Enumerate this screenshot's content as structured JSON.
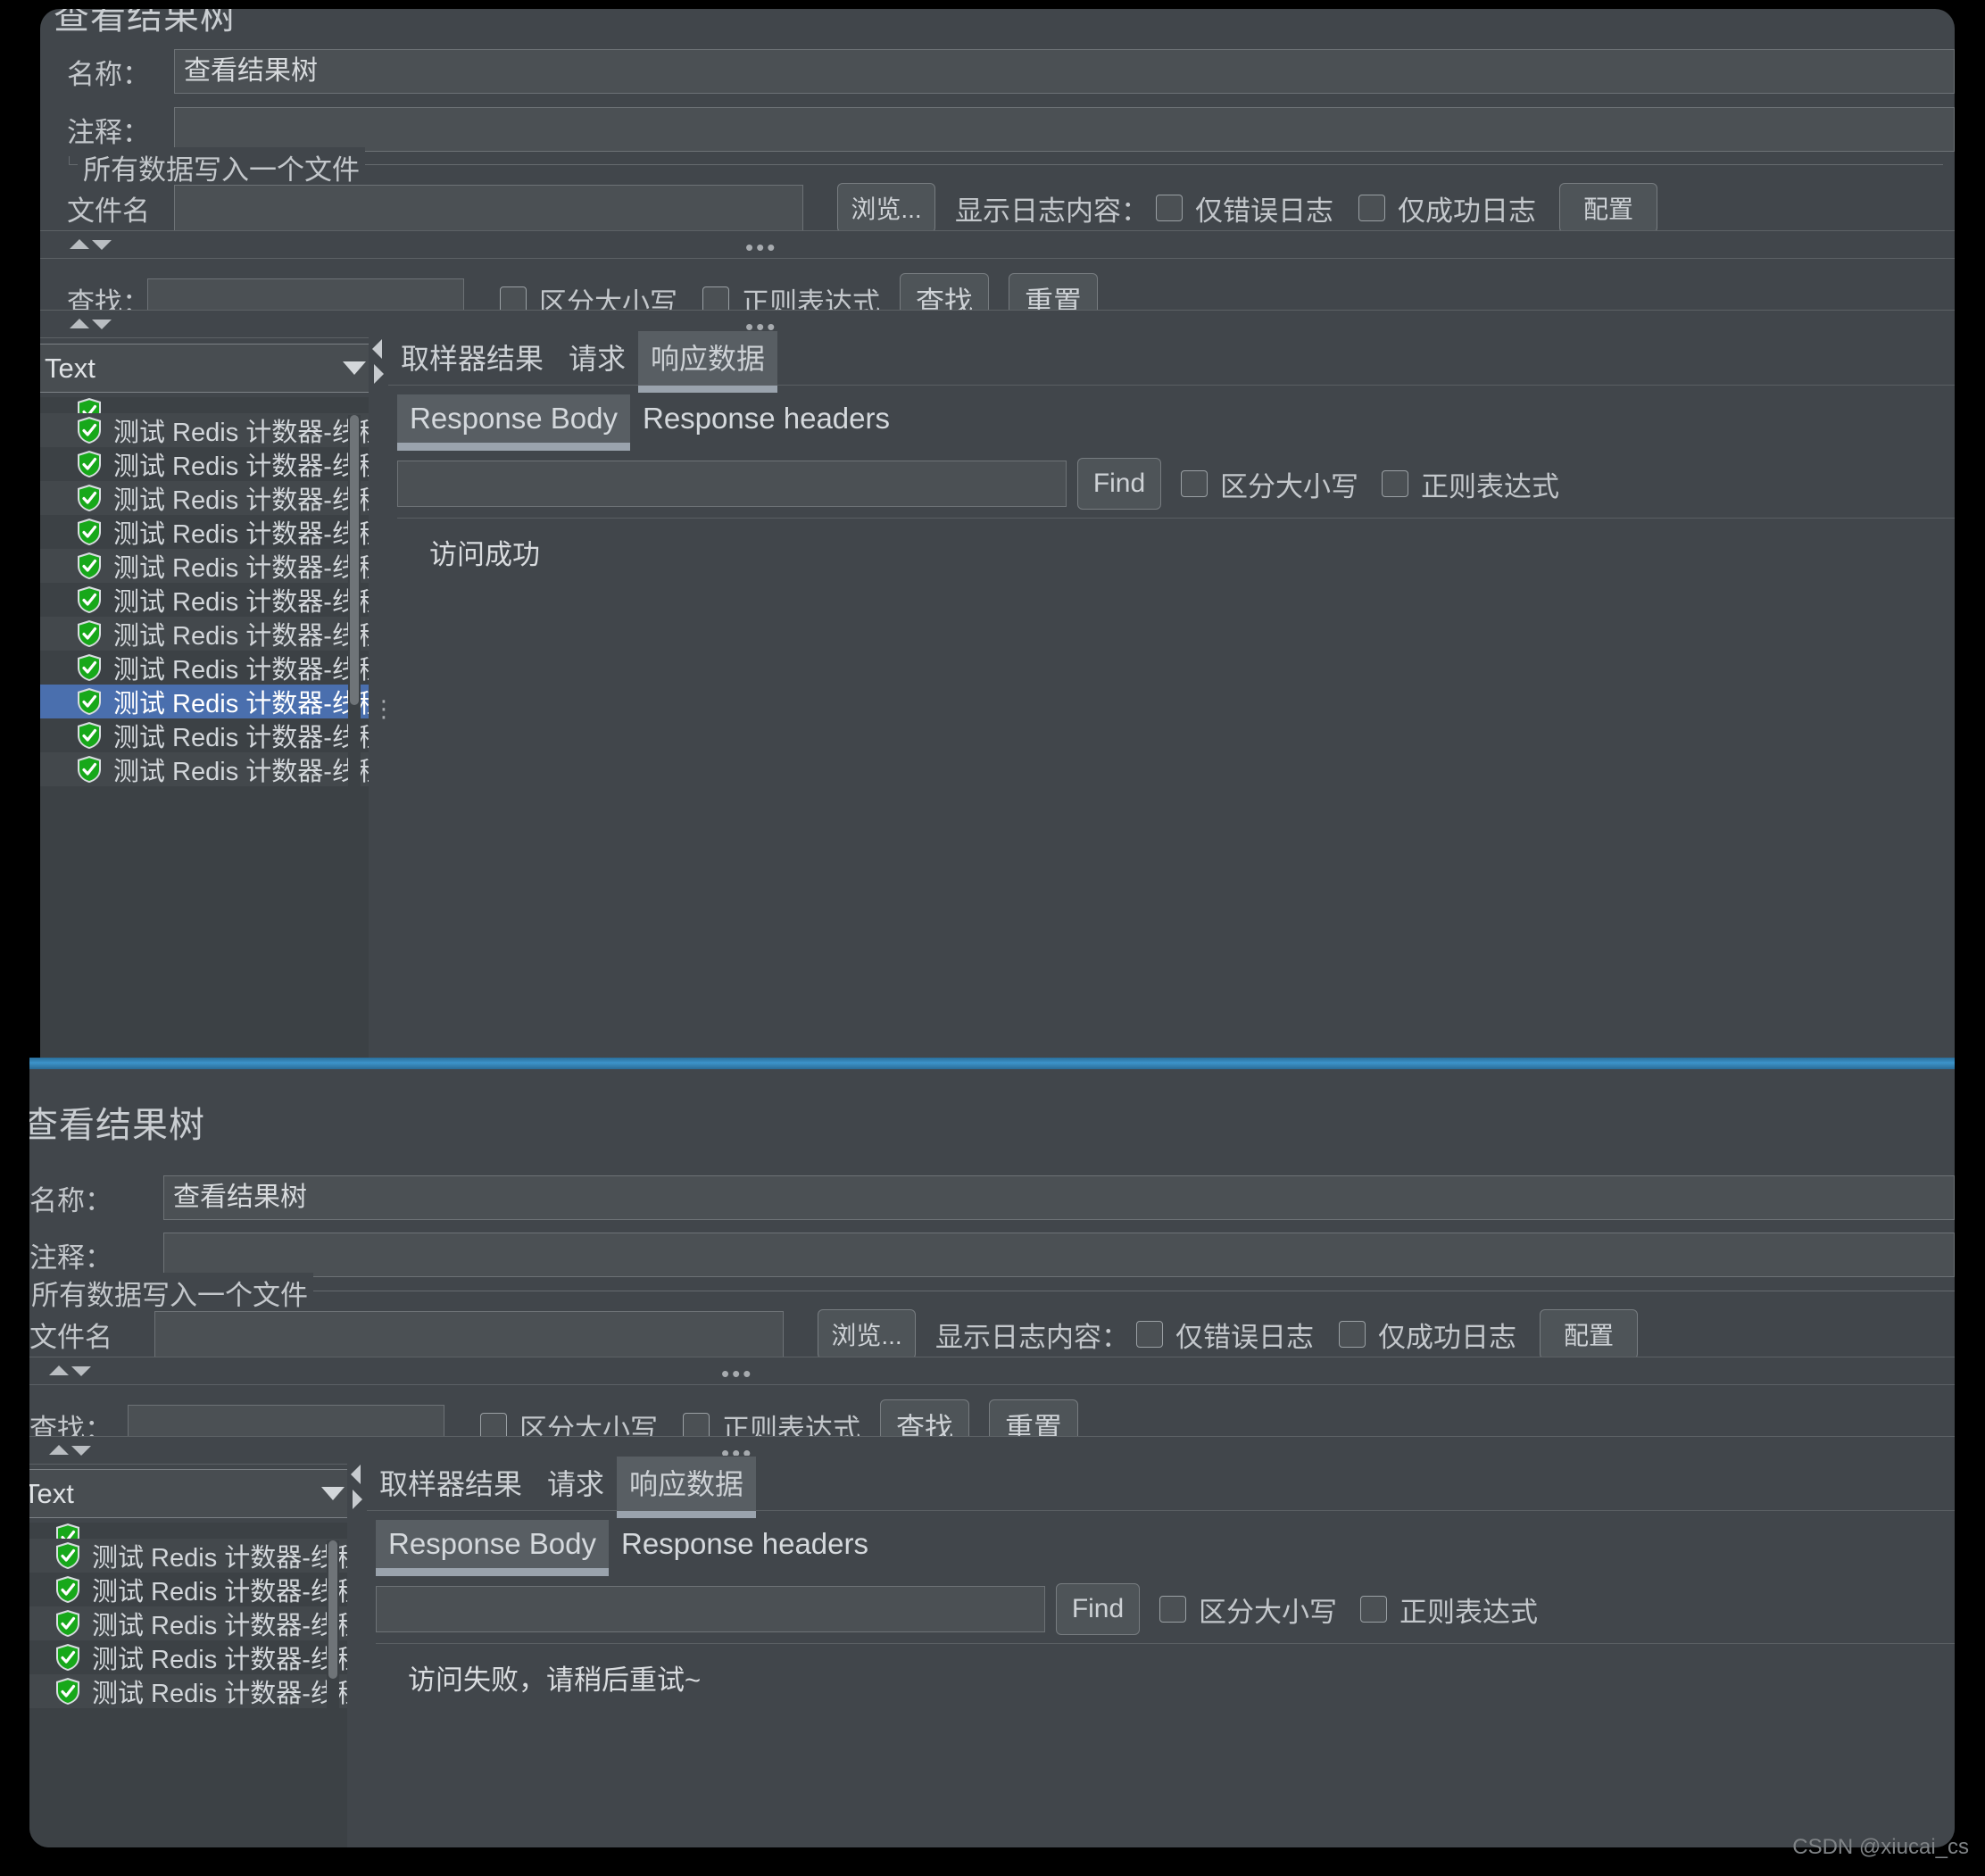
{
  "window_top": {
    "title": "查看结果树",
    "name_label": "名称：",
    "name_value": "查看结果树",
    "comment_label": "注释：",
    "comment_value": "",
    "group_caption": "所有数据写入一个文件",
    "filename_label": "文件名",
    "filename_value": "",
    "browse_button": "浏览...",
    "log_label": "显示日志内容：",
    "cb_error_only": "仅错误日志",
    "cb_success_only": "仅成功日志",
    "config_button": "配置",
    "search_label": "查找：",
    "search_value": "",
    "cb_match_case": "区分大小写",
    "cb_regex": "正则表达式",
    "find_button": "查找",
    "reset_button": "重置",
    "render_selector": "Text",
    "tabs": [
      {
        "label": "取样器结果",
        "active": false
      },
      {
        "label": "请求",
        "active": false
      },
      {
        "label": "响应数据",
        "active": true
      }
    ],
    "subtabs": [
      {
        "label": "Response Body",
        "active": true
      },
      {
        "label": "Response headers",
        "active": false
      }
    ],
    "body_find_value": "",
    "body_find_button": "Find",
    "body_cb_match_case": "区分大小写",
    "body_cb_regex": "正则表达式",
    "response_body": "访问成功",
    "tree_items": [
      {
        "label": "测试 Redis 计数器-线程安全",
        "status": "ok",
        "selected": false
      },
      {
        "label": "测试 Redis 计数器-线程安全",
        "status": "ok",
        "selected": false
      },
      {
        "label": "测试 Redis 计数器-线程安全",
        "status": "ok",
        "selected": false
      },
      {
        "label": "测试 Redis 计数器-线程安全",
        "status": "ok",
        "selected": false
      },
      {
        "label": "测试 Redis 计数器-线程安全",
        "status": "ok",
        "selected": false
      },
      {
        "label": "测试 Redis 计数器-线程安全",
        "status": "ok",
        "selected": false
      },
      {
        "label": "测试 Redis 计数器-线程安全",
        "status": "ok",
        "selected": false
      },
      {
        "label": "测试 Redis 计数器-线程安全",
        "status": "ok",
        "selected": false
      },
      {
        "label": "测试 Redis 计数器-线程安全",
        "status": "ok",
        "selected": true
      },
      {
        "label": "测试 Redis 计数器-线程安全",
        "status": "ok",
        "selected": false
      },
      {
        "label": "测试 Redis 计数器-线程安全",
        "status": "ok",
        "selected": false
      }
    ]
  },
  "window_bottom": {
    "title": "查看结果树",
    "name_label": "名称：",
    "name_value": "查看结果树",
    "comment_label": "注释：",
    "comment_value": "",
    "group_caption": "所有数据写入一个文件",
    "filename_label": "文件名",
    "filename_value": "",
    "browse_button": "浏览...",
    "log_label": "显示日志内容：",
    "cb_error_only": "仅错误日志",
    "cb_success_only": "仅成功日志",
    "config_button": "配置",
    "search_label": "查找：",
    "search_value": "",
    "cb_match_case": "区分大小写",
    "cb_regex": "正则表达式",
    "find_button": "查找",
    "reset_button": "重置",
    "render_selector": "Text",
    "tabs": [
      {
        "label": "取样器结果",
        "active": false
      },
      {
        "label": "请求",
        "active": false
      },
      {
        "label": "响应数据",
        "active": true
      }
    ],
    "subtabs": [
      {
        "label": "Response Body",
        "active": true
      },
      {
        "label": "Response headers",
        "active": false
      }
    ],
    "body_find_value": "",
    "body_find_button": "Find",
    "body_cb_match_case": "区分大小写",
    "body_cb_regex": "正则表达式",
    "response_body": "访问失败，请稍后重试~",
    "tree_items": [
      {
        "label": "测试 Redis 计数器-线程安全",
        "status": "ok",
        "selected": false
      },
      {
        "label": "测试 Redis 计数器-线程安全",
        "status": "ok",
        "selected": false
      },
      {
        "label": "测试 Redis 计数器-线程安全",
        "status": "ok",
        "selected": false
      },
      {
        "label": "测试 Redis 计数器-线程安全",
        "status": "ok",
        "selected": false
      },
      {
        "label": "测试 Redis 计数器-线程安全",
        "status": "ok",
        "selected": false
      }
    ]
  },
  "watermark": "CSDN @xiucai_cs",
  "colors": {
    "panel_bg": "#41464b",
    "field_bg": "#4b5054",
    "selection_blue": "#4a6fae",
    "status_green": "#17a81a",
    "active_window_edge": "#3c93c9"
  }
}
